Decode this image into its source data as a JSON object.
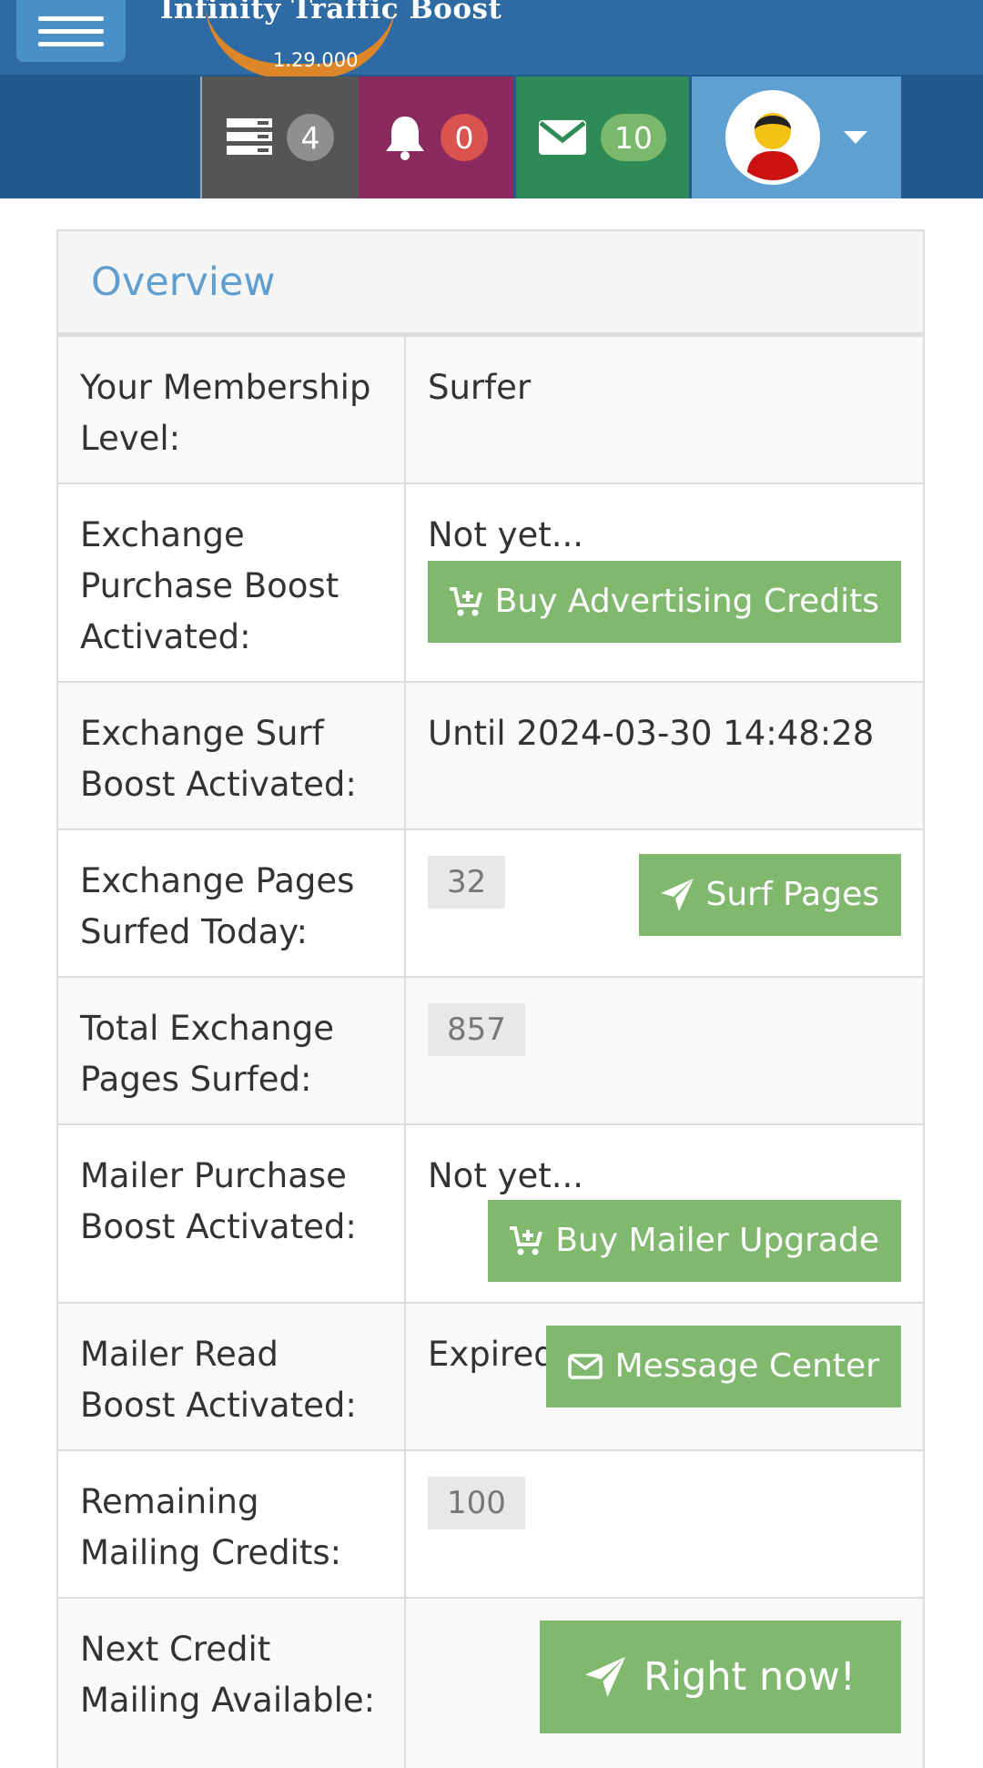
{
  "header": {
    "app_title": "Infinity Traffic Boost",
    "version": "1.29.000"
  },
  "nav": {
    "queue_count": "4",
    "notifications_count": "0",
    "messages_count": "10",
    "colors": {
      "queue_tile": "#555555",
      "notifications_tile": "#8b2a5e",
      "messages_tile": "#2e8b57",
      "profile_tile": "#5fa0d2"
    }
  },
  "overview": {
    "title": "Overview",
    "rows": [
      {
        "label": "Your Membership Level:",
        "value": "Surfer"
      },
      {
        "label": "Exchange Purchase Boost Activated:",
        "value": "Not yet...",
        "button": "Buy Advertising Credits"
      },
      {
        "label": "Exchange Surf Boost Activated:",
        "value": "Until 2024-03-30 14:48:28"
      },
      {
        "label": "Exchange Pages Surfed Today:",
        "value": "32",
        "button": "Surf Pages"
      },
      {
        "label": "Total Exchange Pages Surfed:",
        "value": "857"
      },
      {
        "label": "Mailer Purchase Boost Activated:",
        "value": "Not yet...",
        "button": "Buy Mailer Upgrade"
      },
      {
        "label": "Mailer Read Boost Activated:",
        "value": "Expired",
        "button": "Message Center"
      },
      {
        "label": "Remaining Mailing Credits:",
        "value": "100"
      },
      {
        "label": "Next Credit Mailing Available:",
        "button": "Right now!"
      }
    ]
  },
  "icons": {
    "menu": "hamburger-icon",
    "queue": "server-icon",
    "notifications": "bell-icon",
    "messages": "envelope-icon",
    "profile": "avatar",
    "dropdown": "caret-down-icon",
    "cart": "cart-plus-icon",
    "send": "paper-plane-icon",
    "mail": "envelope-outline-icon"
  },
  "theme": {
    "button_green": "#80b86e",
    "heading_blue": "#5f9ed0",
    "header_blue": "#2e6aa3"
  }
}
